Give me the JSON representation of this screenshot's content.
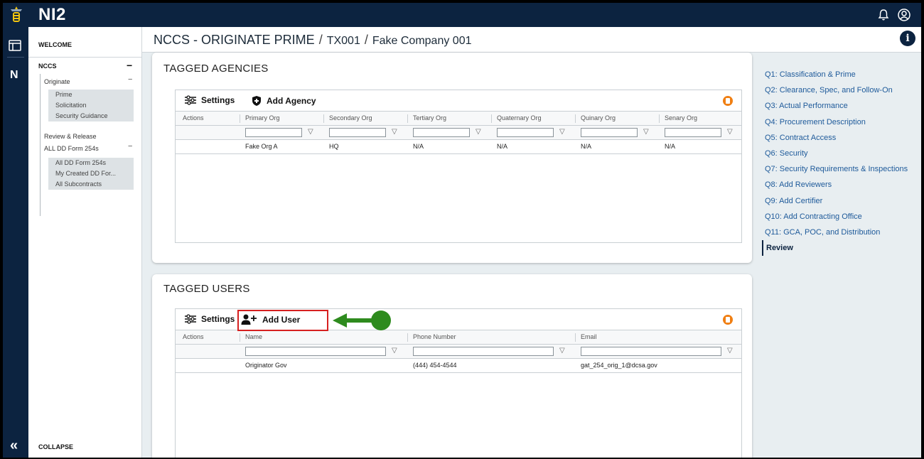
{
  "app": {
    "title": "NI2"
  },
  "rail": {
    "letter": "N",
    "collapse_glyph": "«"
  },
  "sidenav": {
    "welcome": "WELCOME",
    "section": "NCCS",
    "section_toggle": "−",
    "items": [
      {
        "label": "Originate",
        "toggle": "−"
      },
      {
        "label": "Review & Release"
      },
      {
        "label": "ALL DD Form 254s",
        "toggle": "−"
      }
    ],
    "originate_children": [
      "Prime",
      "Solicitation",
      "Security Guidance"
    ],
    "all_children": [
      "All DD Form 254s",
      "My Created DD For...",
      "All Subcontracts"
    ],
    "collapse": "COLLAPSE"
  },
  "breadcrumb": {
    "parts": [
      "NCCS - ORIGINATE PRIME",
      "TX001",
      "Fake Company 001"
    ],
    "separator": "/"
  },
  "info_glyph": "i",
  "agencies": {
    "title": "TAGGED AGENCIES",
    "settings_label": "Settings",
    "add_label": "Add Agency",
    "columns": [
      "Actions",
      "Primary Org",
      "Secondary Org",
      "Tertiary Org",
      "Quaternary Org",
      "Quinary Org",
      "Senary Org"
    ],
    "rows": [
      [
        "",
        "Fake Org A",
        "HQ",
        "N/A",
        "N/A",
        "N/A",
        "N/A"
      ]
    ]
  },
  "users": {
    "title": "TAGGED USERS",
    "settings_label": "Settings",
    "add_label": "Add User",
    "columns": [
      "Actions",
      "Name",
      "Phone Number",
      "Email"
    ],
    "rows": [
      [
        "",
        "Originator Gov",
        "(444) 454-4544",
        "gat_254_orig_1@dcsa.gov"
      ]
    ]
  },
  "questions": [
    "Q1: Classification & Prime",
    "Q2: Clearance, Spec, and Follow-On",
    "Q3: Actual Performance",
    "Q4: Procurement Description",
    "Q5: Contract Access",
    "Q6: Security",
    "Q7: Security Requirements & Inspections",
    "Q8: Add Reviewers",
    "Q9: Add Certifier",
    "Q10: Add Contracting Office",
    "Q11: GCA, POC, and Distribution",
    "Review"
  ],
  "colors": {
    "navy": "#0c2340",
    "link": "#1e5a9a",
    "accent_orange": "#f07f13",
    "annotation_red": "#d62020",
    "annotation_green": "#2e8b1e"
  }
}
